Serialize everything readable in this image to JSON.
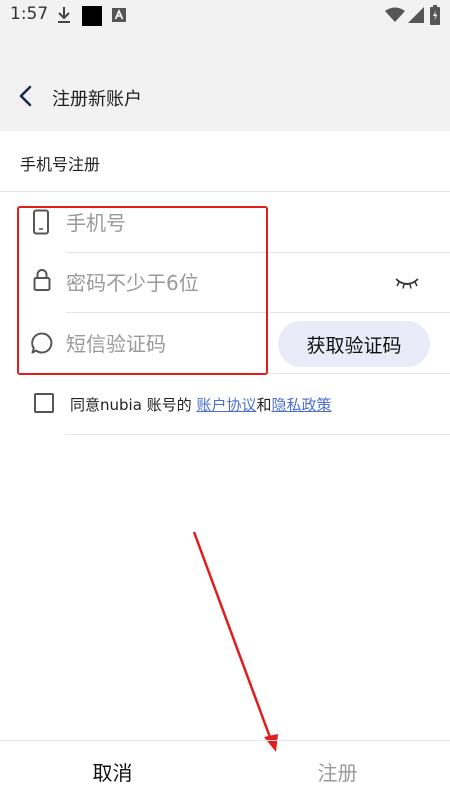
{
  "status_bar": {
    "time": "1:57",
    "icons": [
      "download-icon",
      "black-square-icon",
      "a-badge-icon",
      "wifi-icon",
      "signal-icon",
      "battery-icon"
    ]
  },
  "header": {
    "back_icon": "chevron-left-icon",
    "title": "注册新账户"
  },
  "section": {
    "title": "手机号注册"
  },
  "form": {
    "phone": {
      "icon": "phone-icon",
      "placeholder": "手机号",
      "value": ""
    },
    "password": {
      "icon": "lock-icon",
      "placeholder": "密码不少于6位",
      "value": "",
      "toggle_icon": "eye-closed-icon"
    },
    "sms_code": {
      "icon": "chat-bubble-icon",
      "placeholder": "短信验证码",
      "value": ""
    },
    "get_code_label": "获取验证码"
  },
  "agreement": {
    "checked": false,
    "prefix": "同意nubia 账号的 ",
    "link1": "账户协议",
    "conjunction": "和",
    "link2": "隐私政策"
  },
  "footer": {
    "cancel_label": "取消",
    "register_label": "注册"
  },
  "colors": {
    "accent_link": "#4a6fd1",
    "annotation_red": "#e21b1b",
    "code_button_bg": "#e9ecf8",
    "header_bg": "#f2f2f2"
  }
}
